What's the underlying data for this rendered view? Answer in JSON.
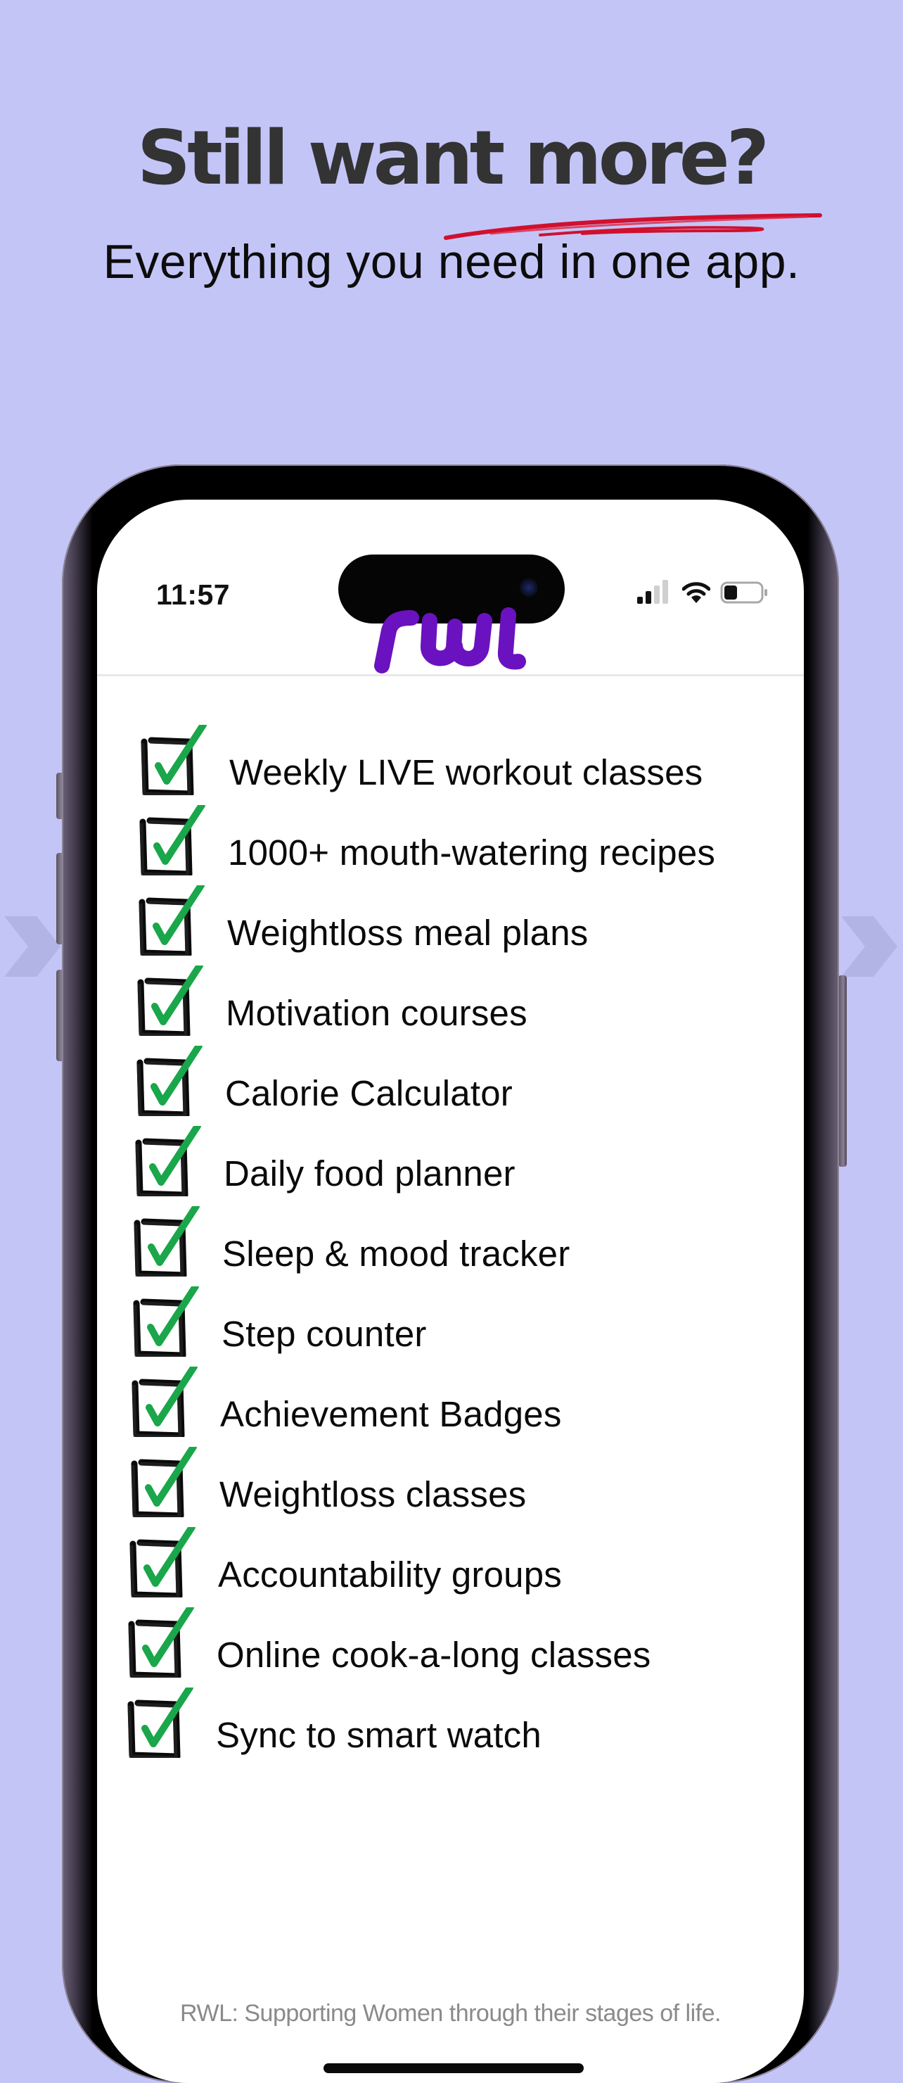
{
  "promo": {
    "headline": "Still want more?",
    "subheadline": "Everything you need in one app.",
    "accent_underline_color": "#d0102e",
    "background_color": "#c4c5f7"
  },
  "navigation": {
    "previous_icon": "chevron-left-icon",
    "next_icon": "chevron-right-icon"
  },
  "status_bar": {
    "time": "11:57",
    "signal_bars_filled": 2,
    "signal_bars_total": 4,
    "wifi": "wifi-icon",
    "battery_level_fraction": 0.35
  },
  "app": {
    "logo_text": "rwl",
    "brand_color": "#6a12c0",
    "check_color": "#1aa64a",
    "features": [
      {
        "label": "Weekly LIVE workout classes",
        "checked": true
      },
      {
        "label": "1000+ mouth-watering recipes",
        "checked": true
      },
      {
        "label": "Weightloss meal plans",
        "checked": true
      },
      {
        "label": "Motivation courses",
        "checked": true
      },
      {
        "label": "Calorie Calculator",
        "checked": true
      },
      {
        "label": "Daily food planner",
        "checked": true
      },
      {
        "label": "Sleep & mood tracker",
        "checked": true
      },
      {
        "label": "Step counter",
        "checked": true
      },
      {
        "label": "Achievement Badges",
        "checked": true
      },
      {
        "label": "Weightloss classes",
        "checked": true
      },
      {
        "label": "Accountability groups",
        "checked": true
      },
      {
        "label": "Online cook-a-long classes",
        "checked": true
      },
      {
        "label": "Sync to smart watch",
        "checked": true
      }
    ],
    "tagline": "RWL:  Supporting Women through their stages of life."
  }
}
